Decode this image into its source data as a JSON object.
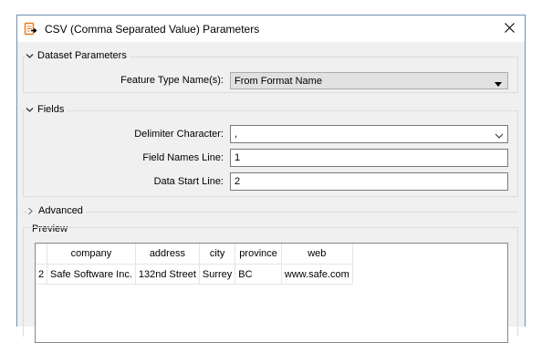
{
  "window": {
    "title": "CSV (Comma Separated Value) Parameters",
    "app_icon": "csv-file-export-icon",
    "close_icon": "close-icon"
  },
  "dataset_parameters": {
    "header": "Dataset Parameters",
    "feature_type_label": "Feature Type Name(s):",
    "feature_type_value": "From Format Name"
  },
  "fields": {
    "header": "Fields",
    "delimiter_label": "Delimiter Character:",
    "delimiter_value": ",",
    "field_names_line_label": "Field Names Line:",
    "field_names_line_value": "1",
    "data_start_line_label": "Data Start Line:",
    "data_start_line_value": "2"
  },
  "advanced": {
    "header": "Advanced"
  },
  "preview": {
    "label": "Preview",
    "columns": [
      "company",
      "address",
      "city",
      "province",
      "web"
    ],
    "rows": [
      {
        "row_number": "2",
        "cells": [
          "Safe Software Inc.",
          "132nd Street",
          "Surrey",
          "BC",
          "www.safe.com"
        ]
      }
    ]
  },
  "colors": {
    "window_border": "#6d8fb7",
    "dialog_background": "#f0f0f0",
    "titlebar_background": "#ffffff",
    "group_border": "#dcdcdc",
    "input_border": "#7a7a7a",
    "combo_background": "#e1e1e1"
  }
}
